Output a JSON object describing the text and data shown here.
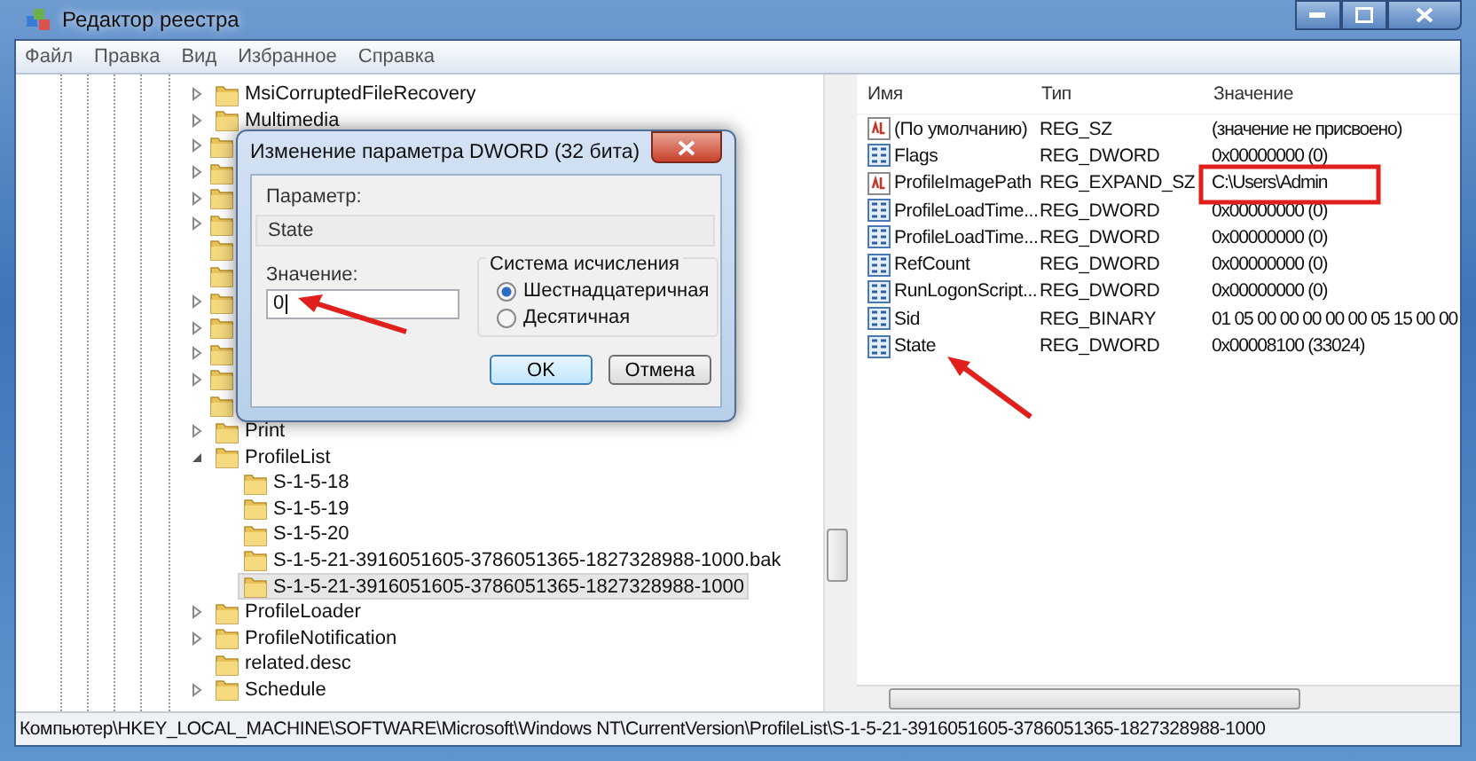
{
  "window": {
    "title": "Редактор реестра"
  },
  "menu": [
    "Файл",
    "Правка",
    "Вид",
    "Избранное",
    "Справка"
  ],
  "tree": [
    {
      "label": "MsiCorruptedFileRecovery",
      "expandable": true,
      "selected": false
    },
    {
      "label": "Multimedia",
      "expandable": true,
      "selected": false
    },
    {
      "expandable": true
    },
    {
      "expandable": true
    },
    {
      "expandable": true
    },
    {
      "expandable": true
    },
    {
      "expandable": false
    },
    {
      "expandable": false
    },
    {
      "expandable": true
    },
    {
      "expandable": true
    },
    {
      "expandable": true
    },
    {
      "expandable": true
    },
    {
      "expandable": false
    },
    {
      "label": "Print",
      "expandable": true,
      "selected": false
    },
    {
      "label": "ProfileList",
      "expandable": true,
      "expanded": true,
      "selected": false,
      "children": [
        {
          "label": "S-1-5-18",
          "selected": false
        },
        {
          "label": "S-1-5-19",
          "selected": false
        },
        {
          "label": "S-1-5-20",
          "selected": false
        },
        {
          "label": "S-1-5-21-3916051605-3786051365-1827328988-1000.bak",
          "selected": false
        },
        {
          "label": "S-1-5-21-3916051605-3786051365-1827328988-1000",
          "selected": true
        }
      ]
    },
    {
      "label": "ProfileLoader",
      "expandable": true,
      "selected": false
    },
    {
      "label": "ProfileNotification",
      "expandable": true,
      "selected": false
    },
    {
      "label": "related.desc",
      "expandable": false,
      "selected": false
    },
    {
      "label": "Schedule",
      "expandable": true,
      "selected": false
    }
  ],
  "values": {
    "columns": [
      "Имя",
      "Тип",
      "Значение"
    ],
    "rows": [
      {
        "kind": "string",
        "name": "(По умолчанию)",
        "type": "REG_SZ",
        "value": "(значение не присвоено)"
      },
      {
        "kind": "binary",
        "name": "Flags",
        "type": "REG_DWORD",
        "value": "0x00000000 (0)"
      },
      {
        "kind": "string",
        "name": "ProfileImagePath",
        "type": "REG_EXPAND_SZ",
        "value": "C:\\Users\\Admin"
      },
      {
        "kind": "binary",
        "name": "ProfileLoadTime...",
        "type": "REG_DWORD",
        "value": "0x00000000 (0)"
      },
      {
        "kind": "binary",
        "name": "ProfileLoadTime...",
        "type": "REG_DWORD",
        "value": "0x00000000 (0)"
      },
      {
        "kind": "binary",
        "name": "RefCount",
        "type": "REG_DWORD",
        "value": "0x00000000 (0)"
      },
      {
        "kind": "binary",
        "name": "RunLogonScript...",
        "type": "REG_DWORD",
        "value": "0x00000000 (0)"
      },
      {
        "kind": "binary",
        "name": "Sid",
        "type": "REG_BINARY",
        "value": "01 05 00 00 00 00 00 05 15 00 00"
      },
      {
        "kind": "binary",
        "name": "State",
        "type": "REG_DWORD",
        "value": "0x00008100 (33024)"
      }
    ]
  },
  "dialog": {
    "title": "Изменение параметра DWORD (32 бита)",
    "parameter_label": "Параметр:",
    "parameter_value": "State",
    "value_label": "Значение:",
    "value": "0",
    "base_group": "Система исчисления",
    "bases": [
      {
        "label": "Шестнадцатеричная",
        "selected": true
      },
      {
        "label": "Десятичная",
        "selected": false
      }
    ],
    "buttons": [
      "OK",
      "Отмена"
    ]
  },
  "status_bar": "Компьютер\\HKEY_LOCAL_MACHINE\\SOFTWARE\\Microsoft\\Windows NT\\CurrentVersion\\ProfileList\\S-1-5-21-3916051605-3786051365-1827328988-1000"
}
